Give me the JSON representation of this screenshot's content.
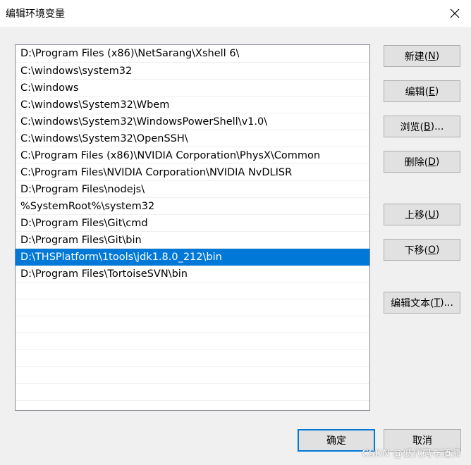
{
  "window": {
    "title": "编辑环境变量",
    "close_glyph": "close-icon"
  },
  "path_list": [
    "D:\\Program Files (x86)\\NetSarang\\Xshell 6\\",
    "C:\\windows\\system32",
    "C:\\windows",
    "C:\\windows\\System32\\Wbem",
    "C:\\windows\\System32\\WindowsPowerShell\\v1.0\\",
    "C:\\windows\\System32\\OpenSSH\\",
    "C:\\Program Files (x86)\\NVIDIA Corporation\\PhysX\\Common",
    "C:\\Program Files\\NVIDIA Corporation\\NVIDIA NvDLISR",
    "D:\\Program Files\\nodejs\\",
    "%SystemRoot%\\system32",
    "D:\\Program Files\\Git\\cmd",
    "D:\\Program Files\\Git\\bin",
    "D:\\THSPlatform\\1tools\\jdk1.8.0_212\\bin",
    "D:\\Program Files\\TortoiseSVN\\bin"
  ],
  "selected_index": 12,
  "buttons": {
    "new": {
      "pre": "新建(",
      "key": "N",
      "post": ")"
    },
    "edit": {
      "pre": "编辑(",
      "key": "E",
      "post": ")"
    },
    "browse": {
      "pre": "浏览(",
      "key": "B",
      "post": ")..."
    },
    "delete": {
      "pre": "删除(",
      "key": "D",
      "post": ")"
    },
    "move_up": {
      "pre": "上移(",
      "key": "U",
      "post": ")"
    },
    "move_down": {
      "pre": "下移(",
      "key": "O",
      "post": ")"
    },
    "edit_text": {
      "pre": "编辑文本(",
      "key": "T",
      "post": ")..."
    }
  },
  "footer": {
    "ok_label": "确定",
    "cancel_label": "取消"
  },
  "watermark": "CSDN @低代码布道师",
  "colors": {
    "selection": "#0078d7",
    "dialog_bg": "#f0f0f0",
    "button_bg": "#e1e1e1"
  }
}
